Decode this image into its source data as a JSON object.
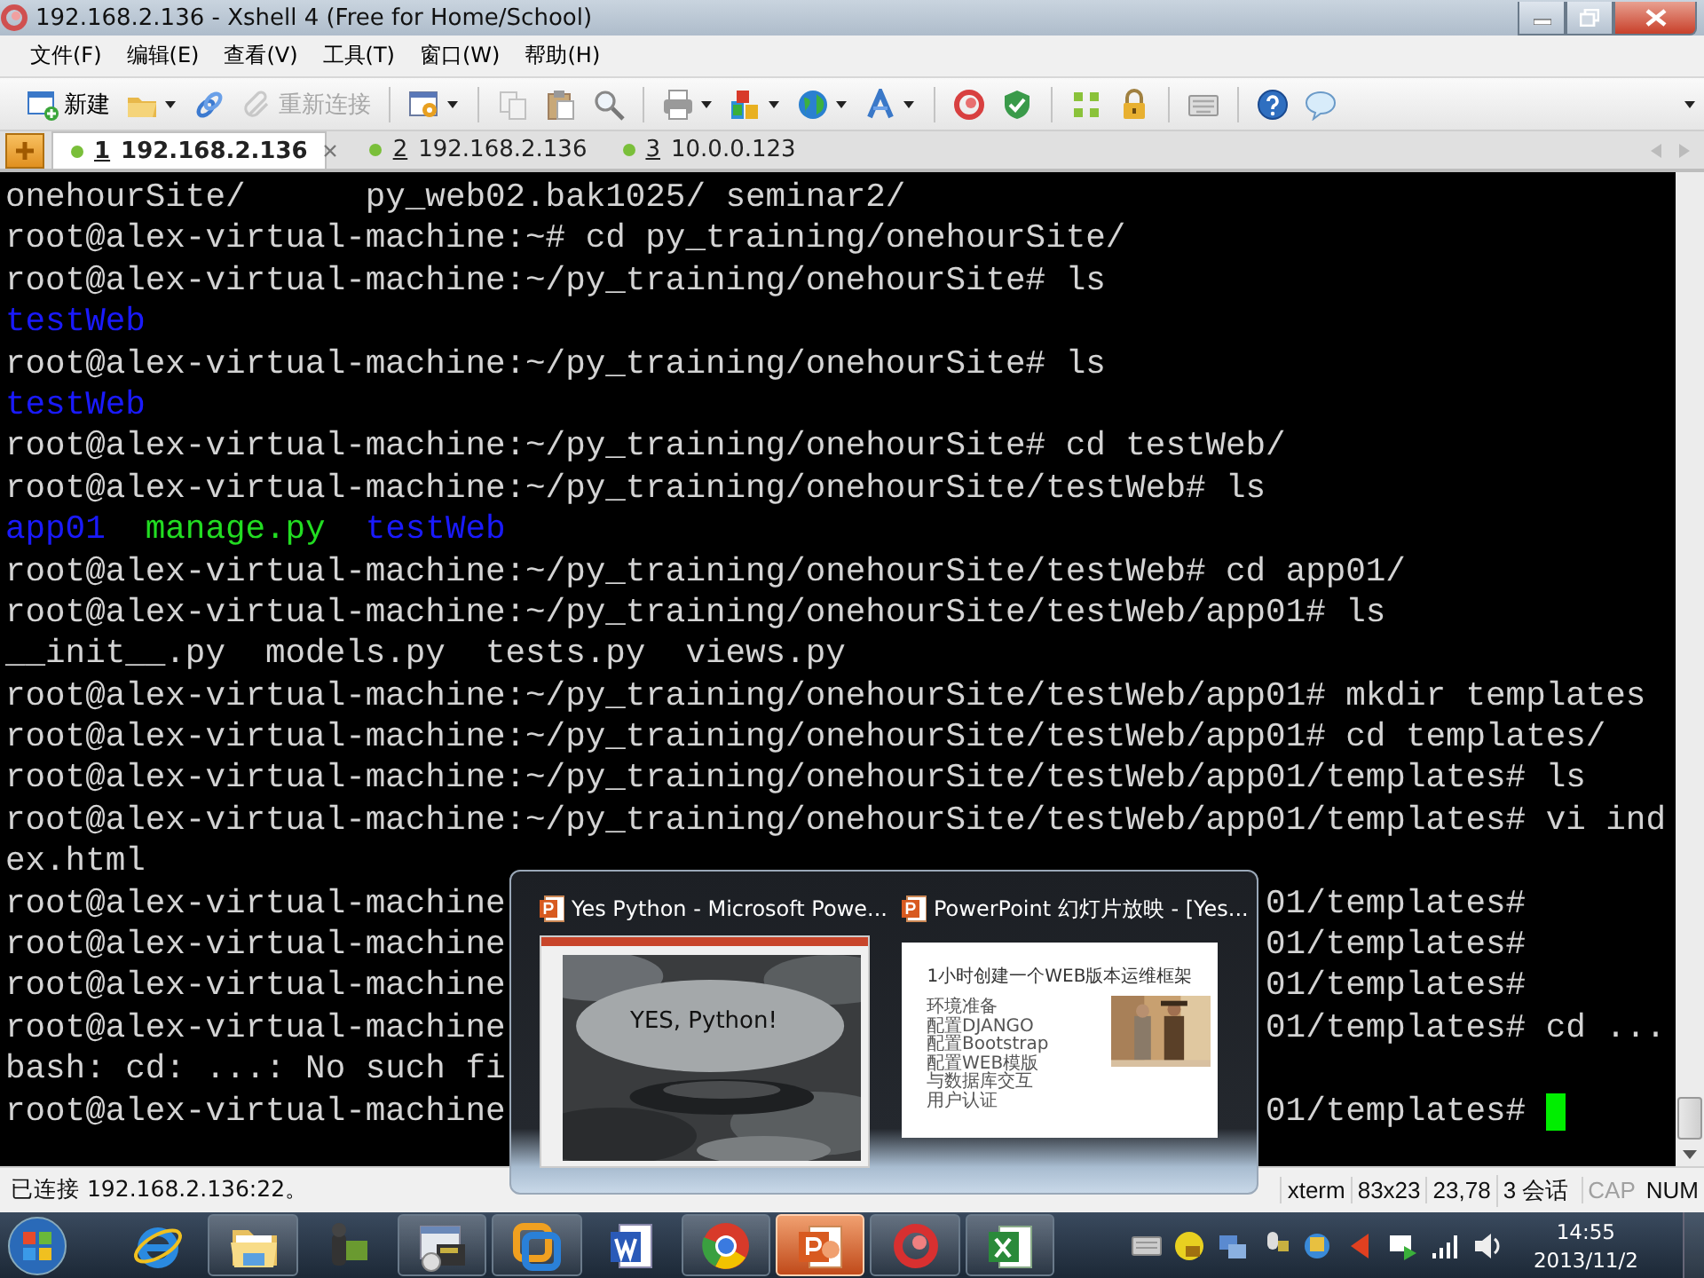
{
  "window": {
    "title": "192.168.2.136 - Xshell 4 (Free for Home/School)"
  },
  "menu": [
    "文件(F)",
    "编辑(E)",
    "查看(V)",
    "工具(T)",
    "窗口(W)",
    "帮助(H)"
  ],
  "toolbar": [
    {
      "kind": "new",
      "label": "新建",
      "disabled": false,
      "dropdown": false
    },
    {
      "kind": "open",
      "disabled": false,
      "dropdown": true
    },
    {
      "kind": "link",
      "disabled": false,
      "dropdown": false
    },
    {
      "kind": "reconnect",
      "label": "重新连接",
      "disabled": true,
      "dropdown": false
    },
    {
      "kind": "separator"
    },
    {
      "kind": "properties",
      "disabled": false,
      "dropdown": true
    },
    {
      "kind": "separator"
    },
    {
      "kind": "copy",
      "disabled": true,
      "dropdown": false
    },
    {
      "kind": "paste",
      "disabled": false,
      "dropdown": false
    },
    {
      "kind": "find",
      "disabled": false,
      "dropdown": false
    },
    {
      "kind": "separator"
    },
    {
      "kind": "print",
      "disabled": false,
      "dropdown": true
    },
    {
      "kind": "transfer",
      "disabled": false,
      "dropdown": true
    },
    {
      "kind": "globe",
      "disabled": false,
      "dropdown": true
    },
    {
      "kind": "font",
      "disabled": false,
      "dropdown": true
    },
    {
      "kind": "separator"
    },
    {
      "kind": "swirl",
      "disabled": false,
      "dropdown": false
    },
    {
      "kind": "shield",
      "disabled": false,
      "dropdown": false
    },
    {
      "kind": "separator"
    },
    {
      "kind": "grid",
      "disabled": false,
      "dropdown": false
    },
    {
      "kind": "lock",
      "disabled": false,
      "dropdown": false
    },
    {
      "kind": "separator"
    },
    {
      "kind": "keyboard",
      "disabled": false,
      "dropdown": false
    },
    {
      "kind": "separator"
    },
    {
      "kind": "help",
      "disabled": false,
      "dropdown": false
    },
    {
      "kind": "chat",
      "disabled": false,
      "dropdown": false
    }
  ],
  "tabs": [
    {
      "number": "1",
      "host": "192.168.2.136",
      "selected": true
    },
    {
      "number": "2",
      "host": "192.168.2.136",
      "selected": false
    },
    {
      "number": "3",
      "host": "10.0.0.123",
      "selected": false
    }
  ],
  "terminal": {
    "cursor_visible": true,
    "lines": [
      {
        "text": "onehourSite/      py_web02.bak1025/ seminar2/"
      },
      {
        "text": "root@alex-virtual-machine:~# cd py_training/onehourSite/"
      },
      {
        "text": "root@alex-virtual-machine:~/py_training/onehourSite# ls"
      },
      {
        "segments": [
          {
            "text": "testWeb",
            "color": "#1a1aff"
          }
        ]
      },
      {
        "text": "root@alex-virtual-machine:~/py_training/onehourSite# ls"
      },
      {
        "segments": [
          {
            "text": "testWeb",
            "color": "#1a1aff"
          }
        ]
      },
      {
        "text": "root@alex-virtual-machine:~/py_training/onehourSite# cd testWeb/"
      },
      {
        "text": "root@alex-virtual-machine:~/py_training/onehourSite/testWeb# ls"
      },
      {
        "segments": [
          {
            "text": "app01",
            "color": "#1a1aff"
          },
          {
            "text": "manage.py",
            "color": "#22dd22"
          },
          {
            "text": "testWeb",
            "color": "#1a1aff"
          }
        ]
      },
      {
        "text": "root@alex-virtual-machine:~/py_training/onehourSite/testWeb# cd app01/"
      },
      {
        "text": "root@alex-virtual-machine:~/py_training/onehourSite/testWeb/app01# ls"
      },
      {
        "text": "__init__.py  models.py  tests.py  views.py"
      },
      {
        "text": "root@alex-virtual-machine:~/py_training/onehourSite/testWeb/app01# mkdir templates"
      },
      {
        "text": "root@alex-virtual-machine:~/py_training/onehourSite/testWeb/app01# cd templates/"
      },
      {
        "text": "root@alex-virtual-machine:~/py_training/onehourSite/testWeb/app01/templates# ls"
      },
      {
        "text": "root@alex-virtual-machine:~/py_training/onehourSite/testWeb/app01/templates# vi ind"
      },
      {
        "text": "ex.html"
      },
      {
        "text": "root@alex-virtual-machine",
        "text_right": "01/templates#"
      },
      {
        "text": "root@alex-virtual-machine",
        "text_right": "01/templates#"
      },
      {
        "text": "root@alex-virtual-machine",
        "text_right": "01/templates#"
      },
      {
        "text": "root@alex-virtual-machine",
        "text_right": "01/templates# cd ..."
      },
      {
        "text": "bash: cd: ...: No such fi"
      },
      {
        "text": "root@alex-virtual-machine",
        "text_right": "01/templates#"
      }
    ]
  },
  "status_bar": {
    "message": "已连接 192.168.2.136:22。",
    "fields": [
      "xterm",
      "83x23",
      "23,78",
      "3 会话"
    ],
    "indicators": [
      {
        "label": "CAP",
        "disabled": true
      },
      {
        "label": "NUM",
        "disabled": false
      }
    ]
  },
  "preview_popup": {
    "windows": [
      {
        "kind": "editor",
        "title": "Yes Python - Microsoft Powe...",
        "slide_text": "YES, Python!"
      },
      {
        "kind": "slideshow",
        "title": "PowerPoint 幻灯片放映 - [Yes...",
        "slide_title": "1小时创建一个WEB版本运维框架",
        "bullets": [
          "环境准备",
          "配置DJANGO",
          "配置Bootstrap",
          "配置WEB模版",
          "与数据库交互",
          "用户认证"
        ]
      }
    ]
  },
  "taskbar": {
    "apps": [
      {
        "kind": "ie",
        "running": false,
        "selected": false
      },
      {
        "kind": "explorer",
        "running": true,
        "selected": false
      },
      {
        "kind": "camera",
        "running": false,
        "selected": false
      },
      {
        "kind": "remote",
        "running": true,
        "selected": false
      },
      {
        "kind": "vmware",
        "running": true,
        "selected": false
      },
      {
        "kind": "word",
        "running": false,
        "selected": false
      },
      {
        "kind": "chrome",
        "running": true,
        "selected": false
      },
      {
        "kind": "powerpoint",
        "running": true,
        "selected": true
      },
      {
        "kind": "xshell",
        "running": true,
        "selected": false
      },
      {
        "kind": "excel",
        "running": true,
        "selected": false
      }
    ],
    "clock": {
      "time": "14:55",
      "date": "2013/11/2"
    }
  }
}
